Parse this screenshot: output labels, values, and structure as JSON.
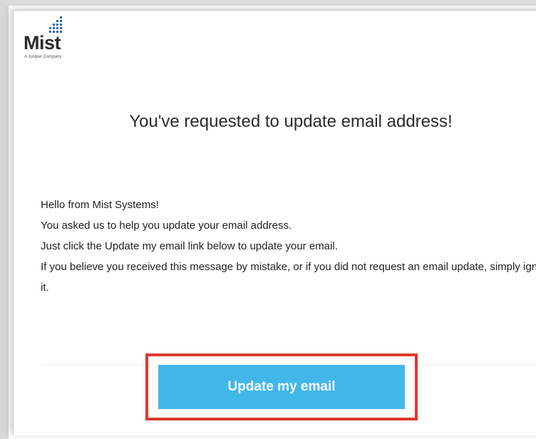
{
  "logo": {
    "name": "Mist",
    "tagline": "A Juniper Company",
    "dot_color": "#1f66b1"
  },
  "email": {
    "heading": "You've requested to update email address!",
    "paragraphs": [
      "Hello from Mist Systems!",
      "You asked us to help you update your email address.",
      "Just click the Update my email link below to update your email.",
      "If you believe you received this message by mistake, or if you did not request an email update, simply ignore it."
    ],
    "button_label": "Update my email"
  },
  "colors": {
    "button": "#42b7e9",
    "highlight": "#e0392b"
  }
}
